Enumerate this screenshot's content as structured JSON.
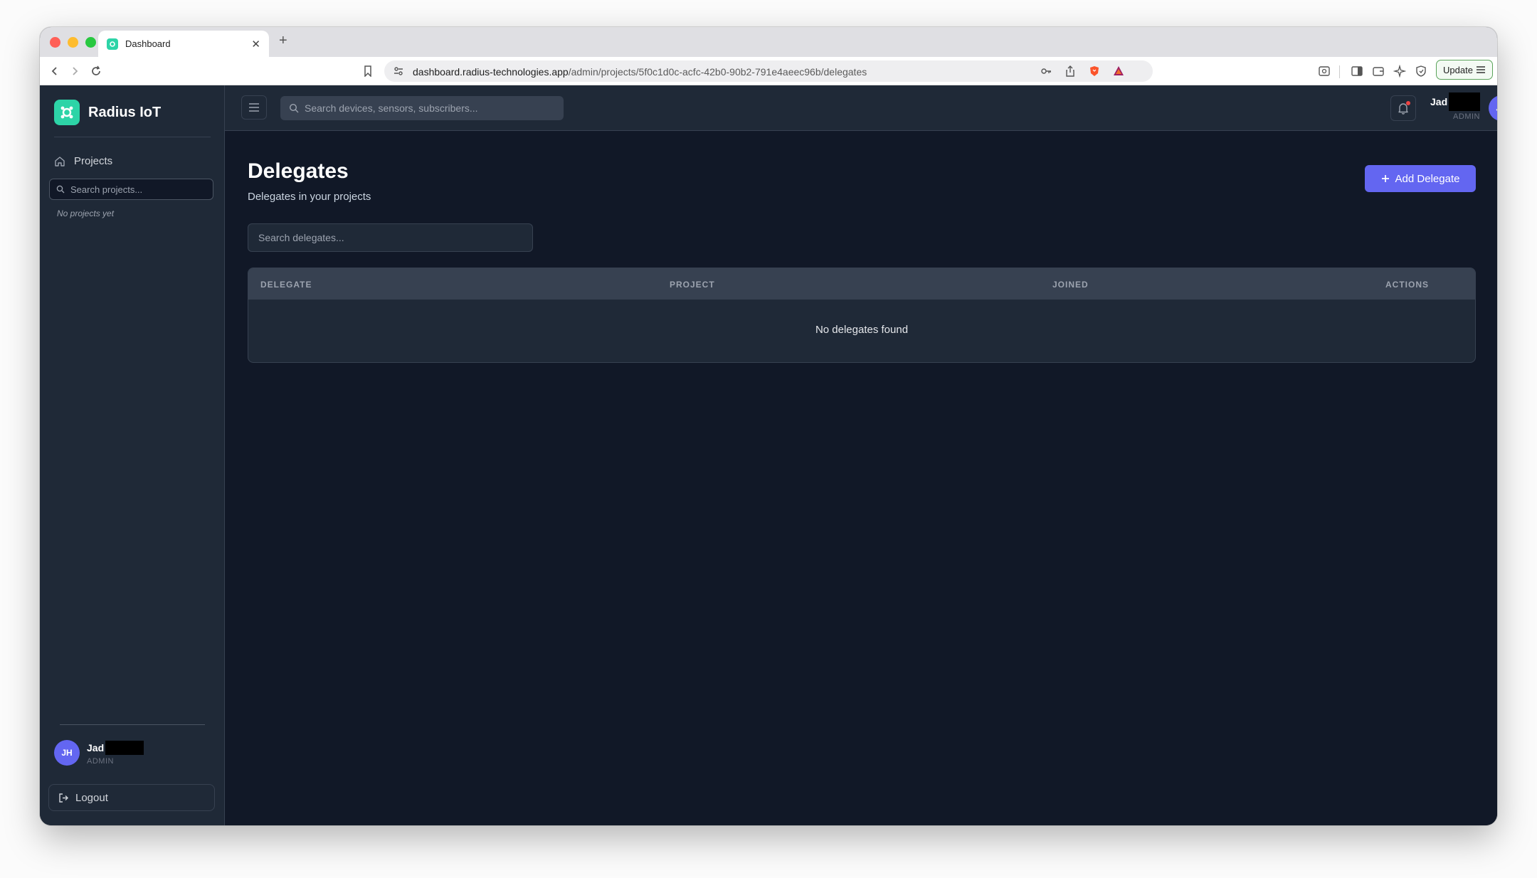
{
  "browser": {
    "tab_title": "Dashboard",
    "url_host": "dashboard.radius-technologies.app",
    "url_path": "/admin/projects/5f0c1d0c-acfc-42b0-90b2-791e4aeec96b/delegates",
    "update_label": "Update"
  },
  "sidebar": {
    "brand": "Radius IoT",
    "nav_projects": "Projects",
    "search_placeholder": "Search projects...",
    "empty_text": "No projects yet",
    "user": {
      "initials": "JH",
      "name": "Jad",
      "role": "ADMIN"
    },
    "logout_label": "Logout"
  },
  "header": {
    "search_placeholder": "Search devices, sensors, subscribers...",
    "user": {
      "name": "Jad",
      "role": "ADMIN",
      "initials": "JH"
    }
  },
  "main": {
    "title": "Delegates",
    "subtitle": "Delegates in your projects",
    "add_button": "Add Delegate",
    "search_placeholder": "Search delegates...",
    "table": {
      "columns": [
        "DELEGATE",
        "PROJECT",
        "JOINED",
        "ACTIONS"
      ],
      "empty_text": "No delegates found"
    }
  },
  "colors": {
    "accent": "#6366f1",
    "brand": "#2dd4a7",
    "background": "#111827",
    "panel": "#1f2937"
  }
}
